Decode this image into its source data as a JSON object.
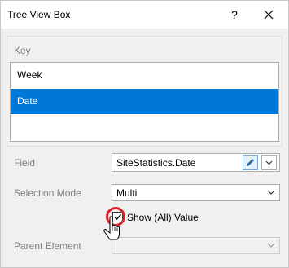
{
  "window": {
    "title": "Tree View Box",
    "help_label": "?"
  },
  "key_group": {
    "label": "Key",
    "items": [
      {
        "label": "Week",
        "selected": false
      },
      {
        "label": "Date",
        "selected": true
      },
      {
        "label": "",
        "selected": false
      }
    ]
  },
  "field": {
    "label": "Field",
    "value": "SiteStatistics.Date"
  },
  "selection_mode": {
    "label": "Selection Mode",
    "value": "Multi"
  },
  "show_all": {
    "label": "Show (All) Value",
    "checked": true
  },
  "parent_element": {
    "label": "Parent Element",
    "value": ""
  },
  "colors": {
    "accent": "#0078d7",
    "highlight_ring": "#d9242b"
  },
  "icons": [
    "close-icon",
    "pencil-icon",
    "chevron-down-icon",
    "cursor-icon"
  ]
}
